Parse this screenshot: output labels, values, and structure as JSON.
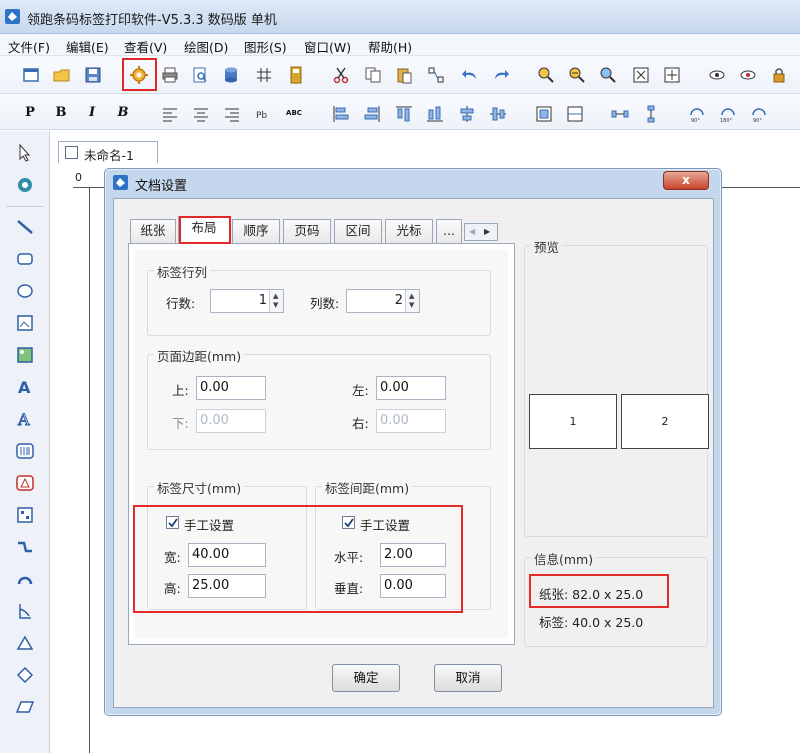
{
  "app": {
    "title": "领跑条码标签打印软件-V5.3.3 数码版 单机"
  },
  "menu": [
    "文件(F)",
    "编辑(E)",
    "查看(V)",
    "绘图(D)",
    "图形(S)",
    "窗口(W)",
    "帮助(H)"
  ],
  "toolbar": {
    "icons": [
      "new-icon",
      "open-icon",
      "save-icon",
      "document-settings-icon",
      "print-icon",
      "print-preview-icon",
      "database-icon",
      "grid-icon",
      "calculator-icon",
      "cut-icon",
      "copy-icon",
      "paste-icon",
      "align-icon",
      "undo-icon",
      "redo-icon",
      "zoom-in-icon",
      "zoom-out-icon",
      "zoom-icon",
      "zoom-fit-icon",
      "zoom-actual-icon",
      "view-icon",
      "hide-icon",
      "lock-icon"
    ],
    "highlighted": "document-settings-icon",
    "format_labels": [
      "P",
      "B",
      "I",
      "B"
    ],
    "format_small_label": "ABC"
  },
  "document": {
    "tab_label": "未命名-1",
    "ruler_zero": "0"
  },
  "dialog": {
    "title": "文档设置",
    "close_label": "x",
    "tabs": [
      "纸张",
      "布局",
      "顺序",
      "页码",
      "区间",
      "光标",
      "..."
    ],
    "active_tab": "布局",
    "label_rows": {
      "legend": "标签行列",
      "rows_label": "行数:",
      "rows_value": "1",
      "cols_label": "列数:",
      "cols_value": "2"
    },
    "margins": {
      "legend": "页面边距(mm)",
      "top_label": "上:",
      "top_value": "0.00",
      "bottom_label": "下:",
      "bottom_value": "0.00",
      "left_label": "左:",
      "left_value": "0.00",
      "right_label": "右:",
      "right_value": "0.00"
    },
    "label_size": {
      "legend": "标签尺寸(mm)",
      "manual_label": "手工设置",
      "manual_checked": true,
      "width_label": "宽:",
      "width_value": "40.00",
      "height_label": "高:",
      "height_value": "25.00"
    },
    "label_spacing": {
      "legend": "标签间距(mm)",
      "manual_label": "手工设置",
      "manual_checked": true,
      "horizontal_label": "水平:",
      "horizontal_value": "2.00",
      "vertical_label": "垂直:",
      "vertical_value": "0.00"
    },
    "preview": {
      "legend": "预览",
      "cells": [
        "1",
        "2"
      ]
    },
    "info": {
      "legend": "信息(mm)",
      "paper": "纸张: 82.0 x 25.0",
      "label": "标签: 40.0 x 25.0"
    },
    "ok_label": "确定",
    "cancel_label": "取消"
  },
  "colors": {
    "highlight": "#e22b2b",
    "titlebar": "#c7d8ee",
    "dialog_frame": "#c5d7ec"
  }
}
